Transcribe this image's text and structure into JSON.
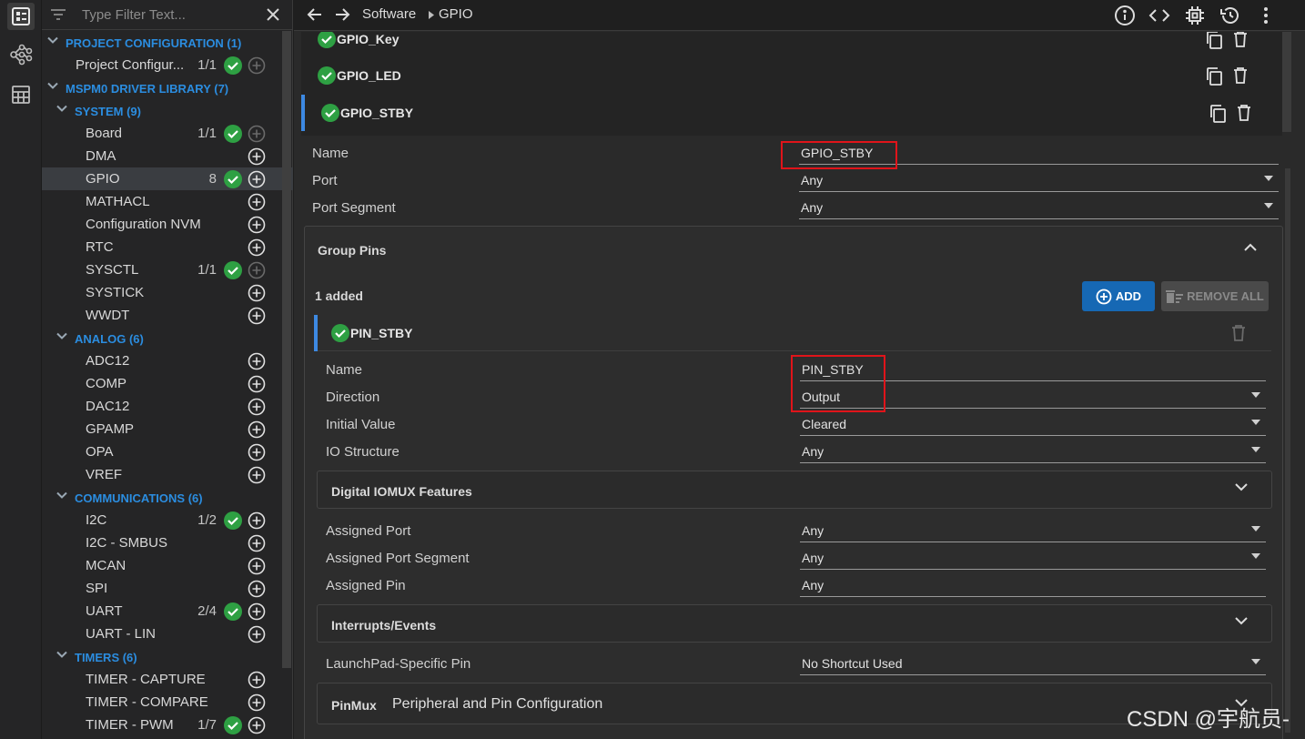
{
  "filter": {
    "placeholder": "Type Filter Text..."
  },
  "sidebar": {
    "tree": [
      {
        "kind": "hdr",
        "level": 0,
        "label": "PROJECT CONFIGURATION (1)"
      },
      {
        "kind": "item",
        "level": 1,
        "label": "Project Configur...",
        "count": "1/1",
        "ok": true,
        "plus_disabled": true
      },
      {
        "kind": "hdr",
        "level": 0,
        "label": "MSPM0 DRIVER LIBRARY (7)"
      },
      {
        "kind": "hdr",
        "level": 1,
        "label": "SYSTEM (9)"
      },
      {
        "kind": "item",
        "level": 2,
        "label": "Board",
        "count": "1/1",
        "ok": true,
        "plus_disabled": true
      },
      {
        "kind": "item",
        "level": 2,
        "label": "DMA"
      },
      {
        "kind": "item",
        "level": 2,
        "label": "GPIO",
        "count": "8",
        "ok": true,
        "selected": true
      },
      {
        "kind": "item",
        "level": 2,
        "label": "MATHACL"
      },
      {
        "kind": "item",
        "level": 2,
        "label": "Configuration NVM"
      },
      {
        "kind": "item",
        "level": 2,
        "label": "RTC"
      },
      {
        "kind": "item",
        "level": 2,
        "label": "SYSCTL",
        "count": "1/1",
        "ok": true,
        "plus_disabled": true
      },
      {
        "kind": "item",
        "level": 2,
        "label": "SYSTICK"
      },
      {
        "kind": "item",
        "level": 2,
        "label": "WWDT"
      },
      {
        "kind": "hdr",
        "level": 1,
        "label": "ANALOG (6)"
      },
      {
        "kind": "item",
        "level": 2,
        "label": "ADC12"
      },
      {
        "kind": "item",
        "level": 2,
        "label": "COMP"
      },
      {
        "kind": "item",
        "level": 2,
        "label": "DAC12"
      },
      {
        "kind": "item",
        "level": 2,
        "label": "GPAMP"
      },
      {
        "kind": "item",
        "level": 2,
        "label": "OPA"
      },
      {
        "kind": "item",
        "level": 2,
        "label": "VREF"
      },
      {
        "kind": "hdr",
        "level": 1,
        "label": "COMMUNICATIONS (6)"
      },
      {
        "kind": "item",
        "level": 2,
        "label": "I2C",
        "count": "1/2",
        "ok": true
      },
      {
        "kind": "item",
        "level": 2,
        "label": "I2C - SMBUS"
      },
      {
        "kind": "item",
        "level": 2,
        "label": "MCAN"
      },
      {
        "kind": "item",
        "level": 2,
        "label": "SPI"
      },
      {
        "kind": "item",
        "level": 2,
        "label": "UART",
        "count": "2/4",
        "ok": true
      },
      {
        "kind": "item",
        "level": 2,
        "label": "UART - LIN"
      },
      {
        "kind": "hdr",
        "level": 1,
        "label": "TIMERS (6)"
      },
      {
        "kind": "item",
        "level": 2,
        "label": "TIMER - CAPTURE"
      },
      {
        "kind": "item",
        "level": 2,
        "label": "TIMER - COMPARE"
      },
      {
        "kind": "item",
        "level": 2,
        "label": "TIMER - PWM",
        "count": "1/7",
        "ok": true
      }
    ]
  },
  "breadcrumb": {
    "software": "Software",
    "gpio": "GPIO"
  },
  "instances": [
    {
      "name": "GPIO_Key"
    },
    {
      "name": "GPIO_LED"
    },
    {
      "name": "GPIO_STBY",
      "selected": true
    }
  ],
  "instance_fields": {
    "name_label": "Name",
    "name_value": "GPIO_STBY",
    "port_label": "Port",
    "port_value": "Any",
    "segment_label": "Port Segment",
    "segment_value": "Any"
  },
  "group_pins": {
    "title": "Group Pins",
    "added": "1 added",
    "add_label": "ADD",
    "remove_all_label": "REMOVE ALL",
    "pin_name": "PIN_STBY",
    "fields": {
      "name_label": "Name",
      "name_value": "PIN_STBY",
      "direction_label": "Direction",
      "direction_value": "Output",
      "initial_label": "Initial Value",
      "initial_value": "Cleared",
      "io_label": "IO Structure",
      "io_value": "Any"
    },
    "digital_iomux": "Digital IOMUX Features",
    "assigned": {
      "port_label": "Assigned Port",
      "port_value": "Any",
      "segment_label": "Assigned Port Segment",
      "segment_value": "Any",
      "pin_label": "Assigned Pin",
      "pin_value": "Any"
    },
    "interrupts": "Interrupts/Events",
    "launchpad_label": "LaunchPad-Specific Pin",
    "launchpad_value": "No Shortcut Used",
    "pinmux_tag": "PinMux",
    "pinmux_title": "Peripheral and Pin Configuration"
  },
  "watermark": "CSDN @宇航员-",
  "colors": {
    "accent": "#2b8de0",
    "ok": "#2ea043",
    "highlight": "#e0141a",
    "add_button": "#1668b4"
  }
}
